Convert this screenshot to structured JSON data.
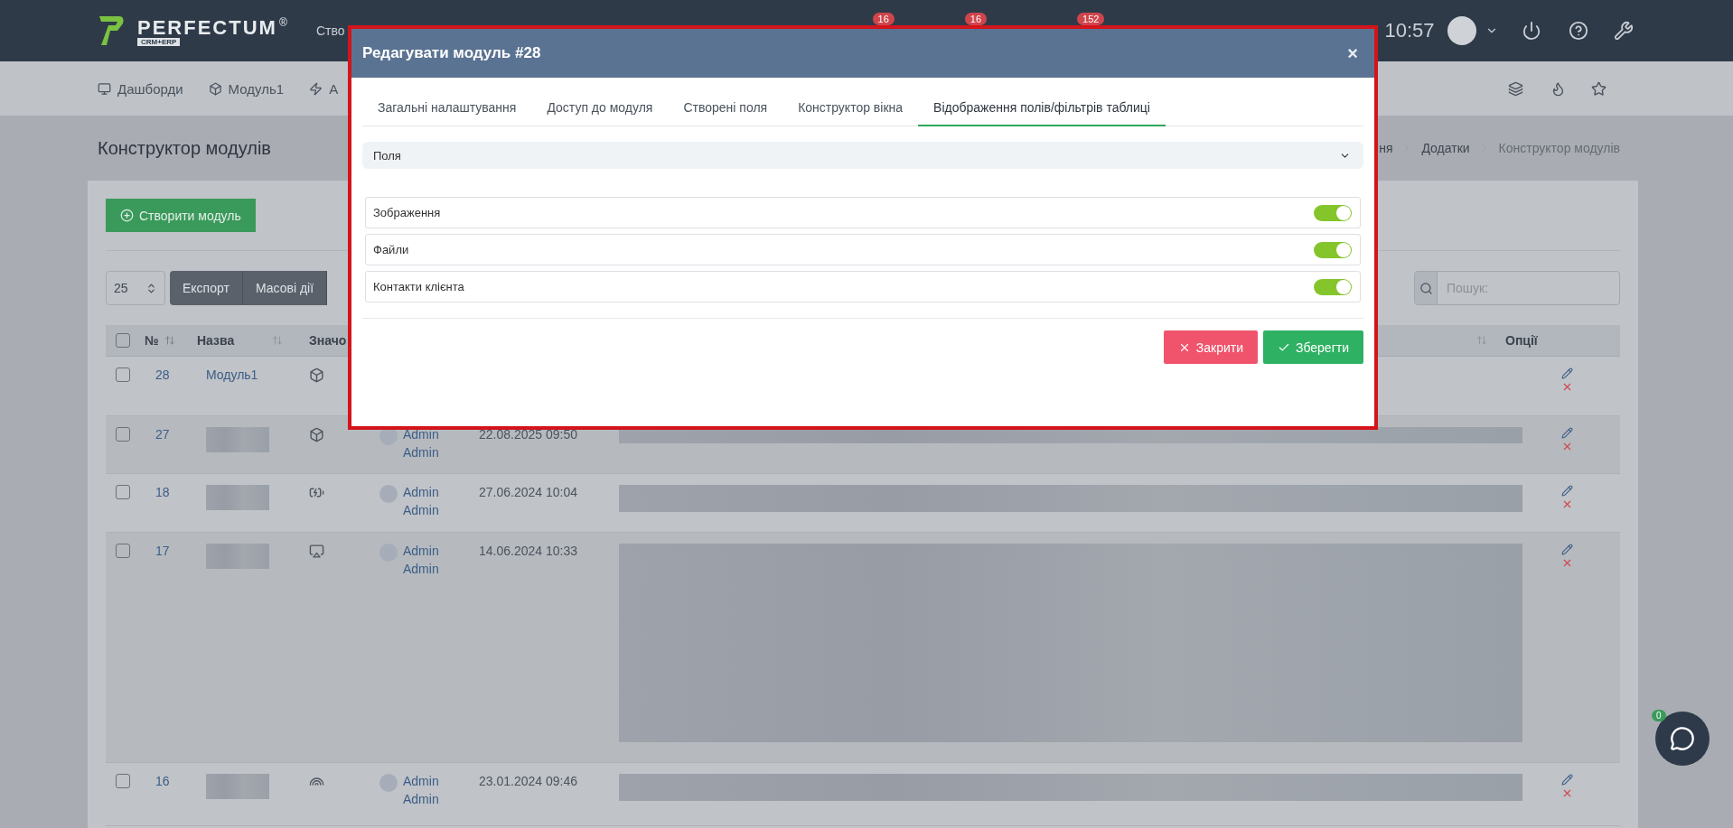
{
  "topbar": {
    "logo": "PERFECTUM",
    "logo_mark": "®",
    "logo_sub": "CRM+ERP",
    "menu_item": "Ство",
    "badges": [
      "16",
      "16",
      "152"
    ],
    "time": "10:57"
  },
  "nav": {
    "items": [
      {
        "label": "Дашборди"
      },
      {
        "label": "Модуль1"
      },
      {
        "label": "А"
      }
    ]
  },
  "page": {
    "title": "Конструктор модулів",
    "breadcrumbs": [
      "ня",
      "Додатки",
      "Конструктор модулів"
    ]
  },
  "toolbar": {
    "create_button": "Створити модуль",
    "page_size": "25",
    "buttons": [
      "Експорт",
      "Масові дії"
    ],
    "search": {
      "placeholder": "Пошук:"
    }
  },
  "table": {
    "all_checked": false,
    "columns": [
      "№",
      "Назва",
      "Значо",
      "Опції"
    ],
    "rows": [
      {
        "id": "28",
        "name": "Модуль1",
        "checked": false
      },
      {
        "id": "27",
        "author": [
          "Admin",
          "Admin"
        ],
        "date": "22.08.2025 09:50",
        "checked": false
      },
      {
        "id": "18",
        "author": [
          "Admin",
          "Admin"
        ],
        "date": "27.06.2024 10:04",
        "checked": false
      },
      {
        "id": "17",
        "author": [
          "Admin",
          "Admin"
        ],
        "date": "14.06.2024 10:33",
        "checked": false
      },
      {
        "id": "16",
        "author": [
          "Admin",
          "Admin"
        ],
        "date": "23.01.2024 09:46",
        "checked": false
      }
    ]
  },
  "modal": {
    "title": "Редагувати модуль #28",
    "close": "×",
    "tabs": [
      {
        "label": "Загальні налаштування",
        "selected": false
      },
      {
        "label": "Доступ до модуля",
        "selected": false
      },
      {
        "label": "Створені поля",
        "selected": false
      },
      {
        "label": "Конструктор вікна",
        "selected": false
      },
      {
        "label": "Відображення полів/фільтрів таблиці",
        "selected": true
      }
    ],
    "section": "Поля",
    "toggles": [
      {
        "label": "Зображення",
        "on": true
      },
      {
        "label": "Файли",
        "on": true
      },
      {
        "label": "Контакти клієнта",
        "on": true
      }
    ],
    "buttons": {
      "close": "Закрити",
      "save": "Зберегти"
    }
  },
  "chat": {
    "badge": "0"
  }
}
